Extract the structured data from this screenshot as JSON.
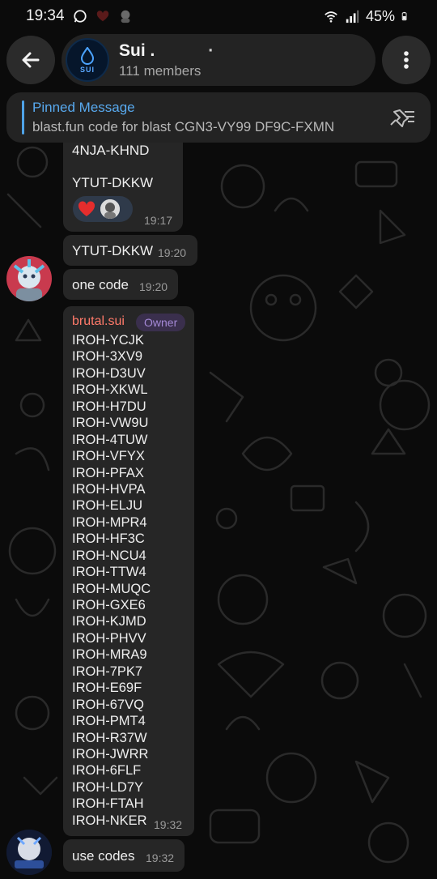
{
  "status_bar": {
    "time": "19:34",
    "battery": "45%",
    "icons": [
      "whatsapp-icon",
      "heart-icon",
      "avatar-icon",
      "wifi-icon",
      "signal-icon",
      "battery-icon"
    ]
  },
  "header": {
    "title": "Sui .",
    "title_extra": "·",
    "subtitle": "111 members",
    "avatar_label": "SUI"
  },
  "pinned": {
    "title": "Pinned Message",
    "text": "blast.fun  code for blast  CGN3-VY99  DF9C-FXMN"
  },
  "messages": {
    "m1": {
      "lines": [
        "4NJA-KHND",
        "YTUT-DKKW"
      ],
      "time": "19:17",
      "reactions": [
        "heart",
        "avatar"
      ]
    },
    "m2": {
      "text": "YTUT-DKKW",
      "time": "19:20"
    },
    "m3": {
      "text": "one code",
      "time": "19:20"
    },
    "m4": {
      "sender": "brutal.sui",
      "badge": "Owner",
      "time": "19:32",
      "codes": [
        "IROH-YCJK",
        "IROH-3XV9",
        "IROH-D3UV",
        "IROH-XKWL",
        "IROH-H7DU",
        "IROH-VW9U",
        "IROH-4TUW",
        "IROH-VFYX",
        "IROH-PFAX",
        "IROH-HVPA",
        "IROH-ELJU",
        "IROH-MPR4",
        "IROH-HF3C",
        "IROH-NCU4",
        "IROH-TTW4",
        "IROH-MUQC",
        "IROH-GXE6",
        "IROH-KJMD",
        "IROH-PHVV",
        "IROH-MRA9",
        "IROH-7PK7",
        "IROH-E69F",
        "IROH-67VQ",
        "IROH-PMT4",
        "IROH-R37W",
        "IROH-JWRR",
        "IROH-6FLF",
        "IROH-LD7Y",
        "IROH-FTAH",
        "IROH-NKER"
      ]
    },
    "m5": {
      "text": "use codes",
      "time": "19:32"
    }
  },
  "colors": {
    "background": "#0b0b0b",
    "bubble": "#262626",
    "accent": "#58a9ee",
    "sender": "#ff7a6a",
    "badge": "#a488d6"
  }
}
